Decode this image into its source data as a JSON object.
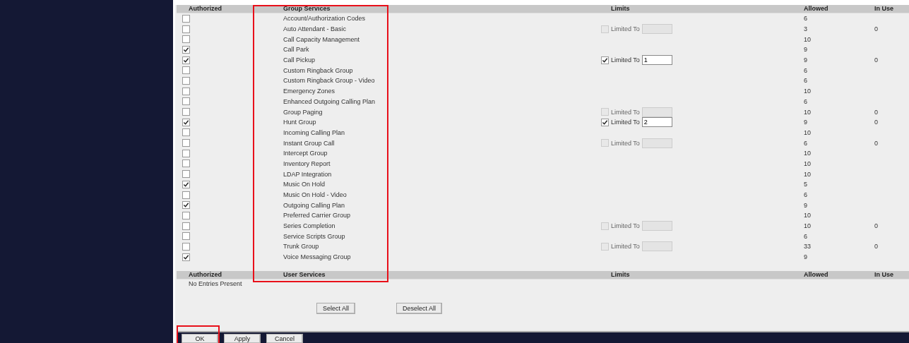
{
  "group_services": {
    "columns": [
      {
        "label": "Authorized",
        "highlighted": false
      },
      {
        "label": "Group Services",
        "highlighted": true
      },
      {
        "label": "Limits",
        "highlighted": false
      },
      {
        "label": "Allowed",
        "highlighted": false
      },
      {
        "label": "In Use",
        "highlighted": false
      }
    ],
    "rows": [
      {
        "authorized": false,
        "service": "Account/Authorization Codes",
        "allowed": "6"
      },
      {
        "authorized": false,
        "service": "Auto Attendant - Basic",
        "limit": {
          "label": "Limited To",
          "checked": false
        },
        "allowed": "3",
        "in_use": "0"
      },
      {
        "authorized": false,
        "service": "Call Capacity Management",
        "allowed": "10"
      },
      {
        "authorized": true,
        "service": "Call Park",
        "allowed": "9"
      },
      {
        "authorized": true,
        "service": "Call Pickup",
        "limit": {
          "label": "Limited To",
          "checked": true,
          "value": "1"
        },
        "allowed": "9",
        "in_use": "0"
      },
      {
        "authorized": false,
        "service": "Custom Ringback Group",
        "allowed": "6"
      },
      {
        "authorized": false,
        "service": "Custom Ringback Group - Video",
        "allowed": "6"
      },
      {
        "authorized": false,
        "service": "Emergency Zones",
        "allowed": "10"
      },
      {
        "authorized": false,
        "service": "Enhanced Outgoing Calling Plan",
        "allowed": "6"
      },
      {
        "authorized": false,
        "service": "Group Paging",
        "limit": {
          "label": "Limited To",
          "checked": false
        },
        "allowed": "10",
        "in_use": "0"
      },
      {
        "authorized": true,
        "service": "Hunt Group",
        "limit": {
          "label": "Limited To",
          "checked": true,
          "value": "2"
        },
        "allowed": "9",
        "in_use": "0"
      },
      {
        "authorized": false,
        "service": "Incoming Calling Plan",
        "allowed": "10"
      },
      {
        "authorized": false,
        "service": "Instant Group Call",
        "limit": {
          "label": "Limited To",
          "checked": false
        },
        "allowed": "6",
        "in_use": "0"
      },
      {
        "authorized": false,
        "service": "Intercept Group",
        "allowed": "10"
      },
      {
        "authorized": false,
        "service": "Inventory Report",
        "allowed": "10"
      },
      {
        "authorized": false,
        "service": "LDAP Integration",
        "allowed": "10"
      },
      {
        "authorized": true,
        "service": "Music On Hold",
        "allowed": "5"
      },
      {
        "authorized": false,
        "service": "Music On Hold - Video",
        "allowed": "6"
      },
      {
        "authorized": true,
        "service": "Outgoing Calling Plan",
        "allowed": "9"
      },
      {
        "authorized": false,
        "service": "Preferred Carrier Group",
        "allowed": "10"
      },
      {
        "authorized": false,
        "service": "Series Completion",
        "limit": {
          "label": "Limited To",
          "checked": false
        },
        "allowed": "10",
        "in_use": "0"
      },
      {
        "authorized": false,
        "service": "Service Scripts Group",
        "allowed": "6"
      },
      {
        "authorized": false,
        "service": "Trunk Group",
        "limit": {
          "label": "Limited To",
          "checked": false
        },
        "allowed": "33",
        "in_use": "0"
      },
      {
        "authorized": true,
        "service": "Voice Messaging Group",
        "allowed": "9"
      }
    ]
  },
  "user_services": {
    "columns": [
      "Authorized",
      "User Services",
      "Limits",
      "Allowed",
      "In Use"
    ],
    "empty_message": "No Entries Present"
  },
  "selection_buttons": [
    "Select All",
    "Deselect All"
  ],
  "footer_buttons": [
    {
      "label": "OK",
      "highlighted": true
    },
    {
      "label": "Apply",
      "highlighted": false
    },
    {
      "label": "Cancel",
      "highlighted": false
    }
  ]
}
